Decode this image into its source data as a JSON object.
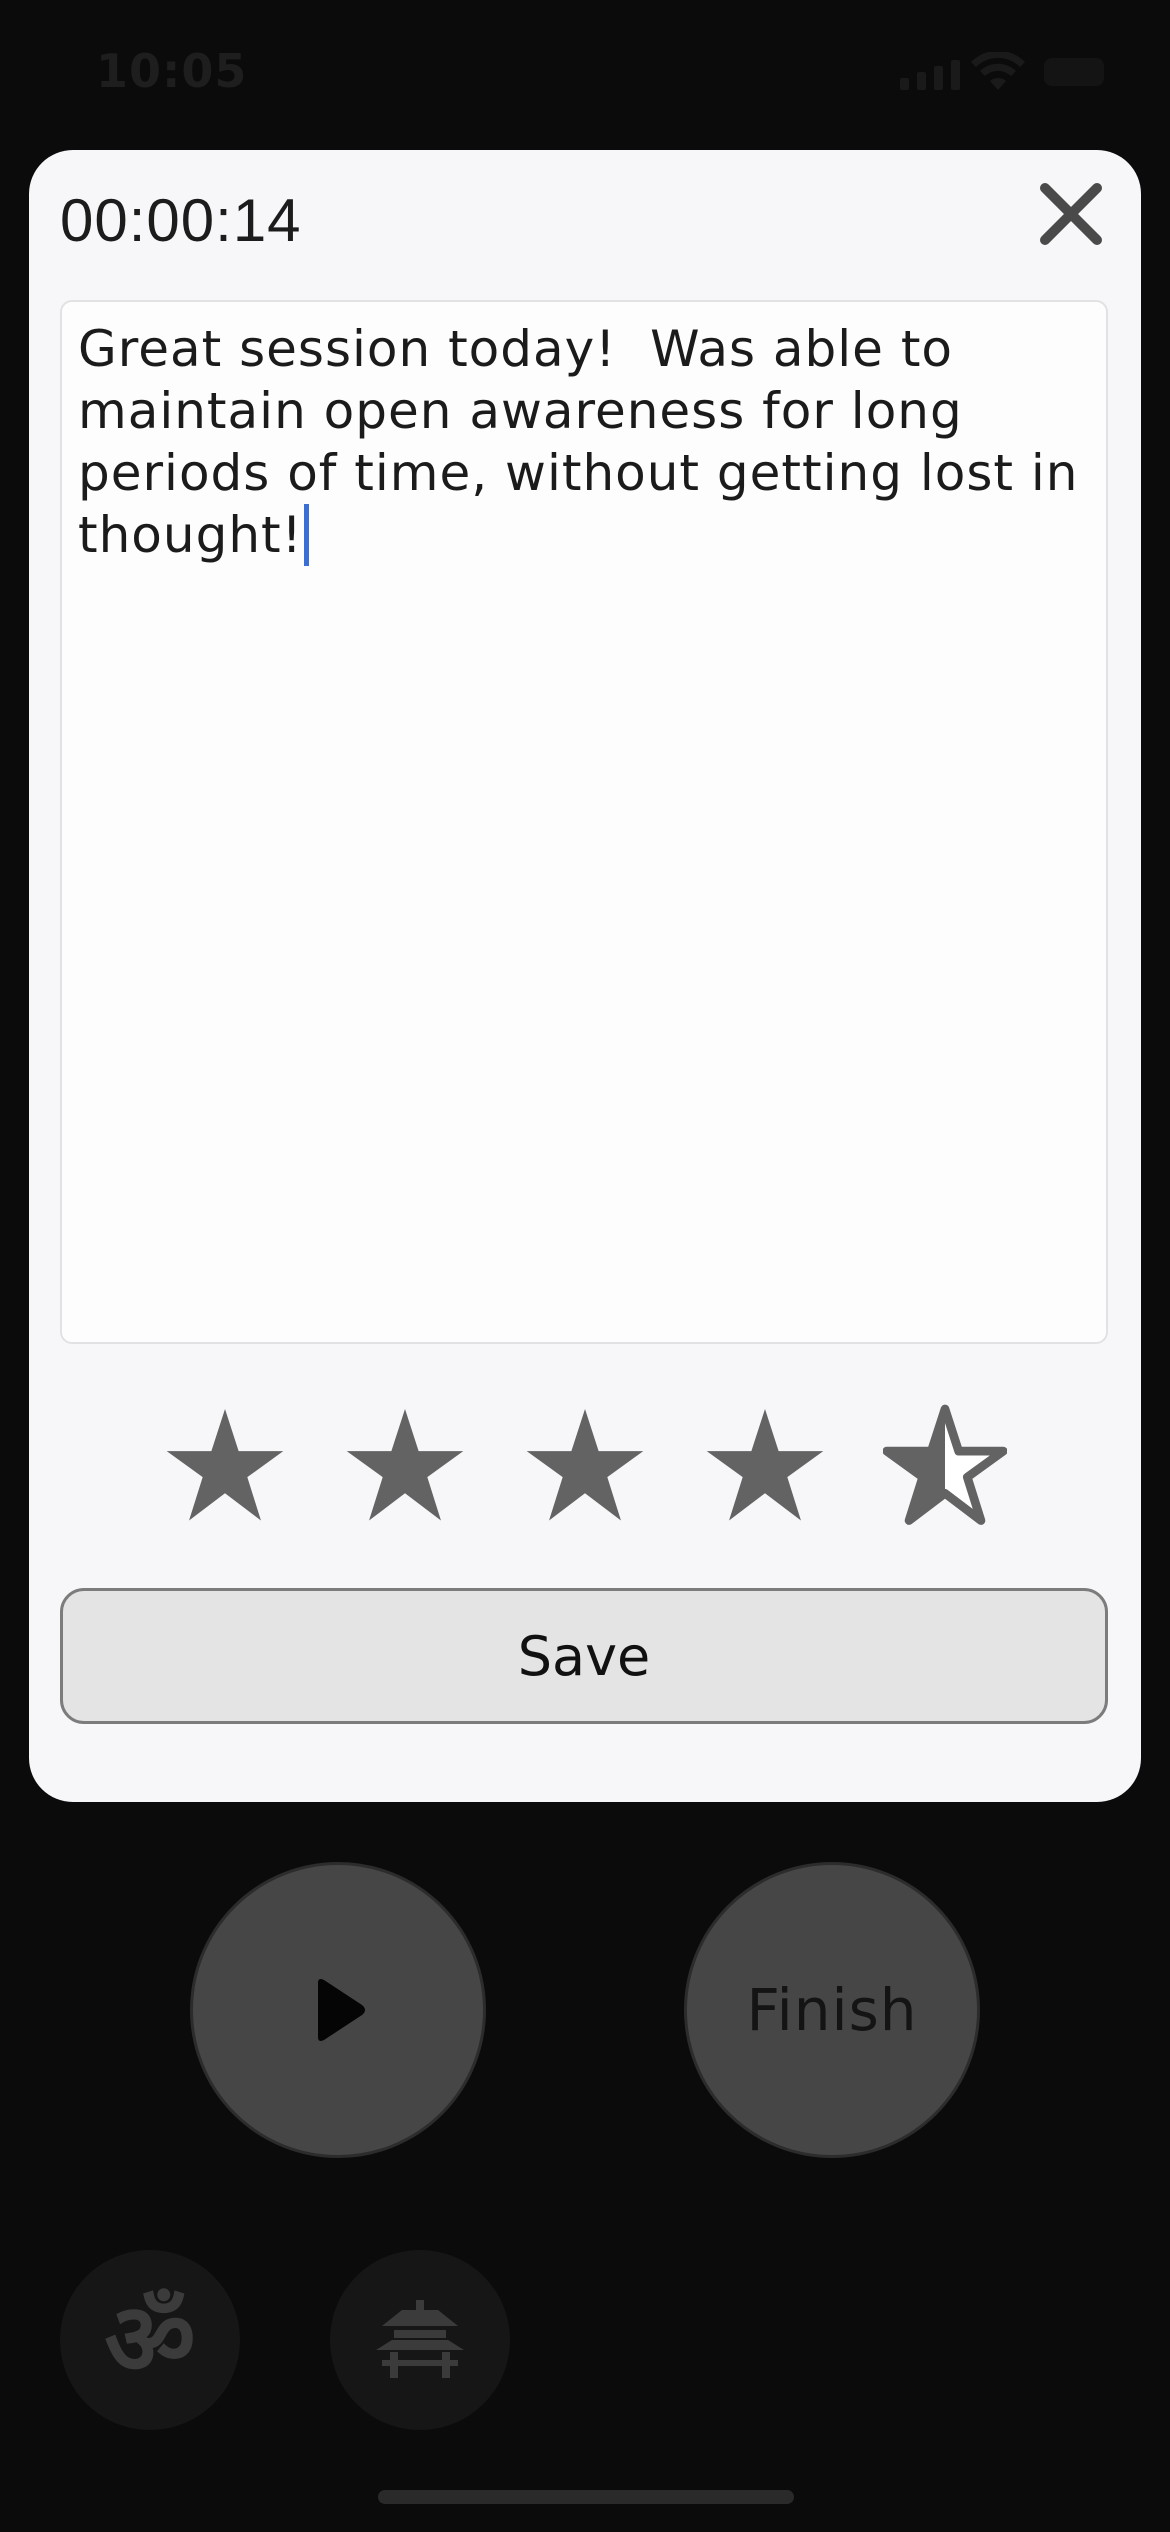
{
  "status_bar": {
    "time": "10:05"
  },
  "modal": {
    "timer": "00:00:14",
    "close_icon": "close-icon",
    "note": {
      "text": "Great session today!  Was able to\nmaintain open awareness for long\nperiods of time, without getting lost in\nthought!"
    },
    "rating": {
      "value": 4.5,
      "max": 5,
      "star_color": "#636363"
    },
    "save_label": "Save"
  },
  "controls": {
    "play_icon": "play-icon",
    "finish_label": "Finish"
  },
  "bottom_nav": {
    "om_glyph": "ॐ",
    "temple_icon": "temple-icon"
  },
  "colors": {
    "background": "#0b0b0b",
    "modal": "#f7f6f9",
    "caret": "#3a6fd8",
    "circle_button": "#464646"
  }
}
